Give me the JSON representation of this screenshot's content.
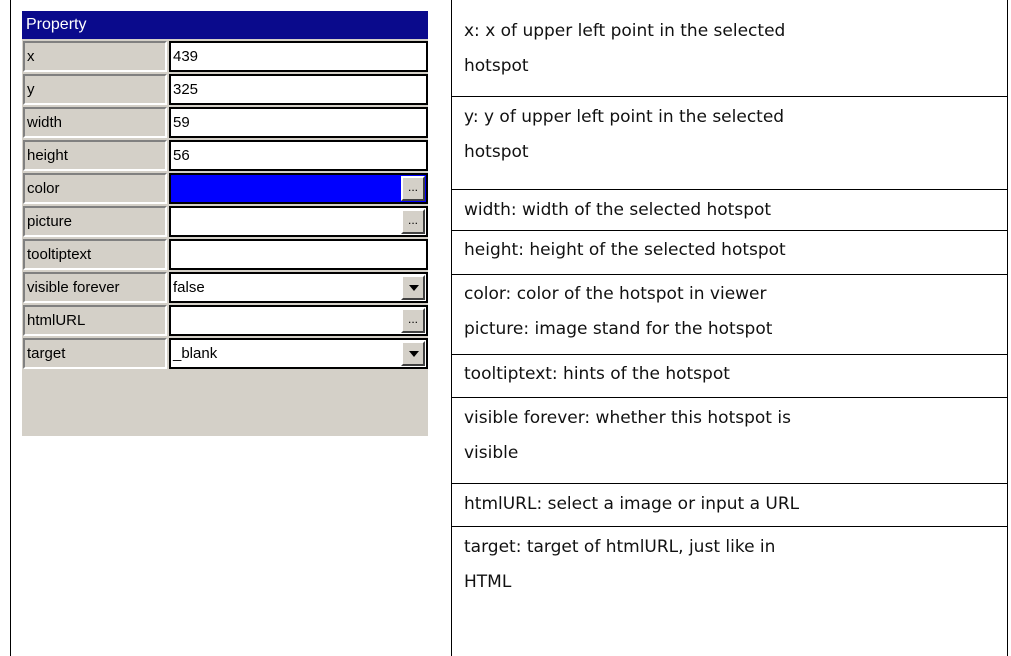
{
  "property_panel": {
    "header": "Property",
    "rows": [
      {
        "label": "x",
        "value": "439"
      },
      {
        "label": "y",
        "value": "325"
      },
      {
        "label": "width",
        "value": "59"
      },
      {
        "label": "height",
        "value": "56"
      },
      {
        "label": "color",
        "value": "",
        "swatch_color": "#0000ff",
        "button": "..."
      },
      {
        "label": "picture",
        "value": "",
        "button": "..."
      },
      {
        "label": "tooltiptext",
        "value": ""
      },
      {
        "label": "visible forever",
        "value": "false",
        "dropdown": true
      },
      {
        "label": "htmlURL",
        "value": "",
        "button": "..."
      },
      {
        "label": "target",
        "value": "_blank",
        "dropdown": true
      }
    ]
  },
  "descriptions": [
    {
      "lines": [
        "x: x of upper left point in the selected",
        "hotspot"
      ]
    },
    {
      "lines": [
        "y: y of upper left point in the selected",
        "hotspot"
      ]
    },
    {
      "lines": [
        "width: width of the selected hotspot"
      ]
    },
    {
      "lines": [
        "height: height of the selected hotspot"
      ]
    },
    {
      "lines": [
        "color: color of the hotspot in viewer",
        "picture: image stand for the hotspot"
      ]
    },
    {
      "lines": [
        "tooltiptext: hints of the hotspot"
      ]
    },
    {
      "lines": [
        "visible forever: whether this hotspot is",
        "visible"
      ]
    },
    {
      "lines": [
        "htmlURL: select a image or input a URL"
      ]
    },
    {
      "lines": [
        "target: target of htmlURL, just like in",
        "HTML"
      ]
    }
  ]
}
